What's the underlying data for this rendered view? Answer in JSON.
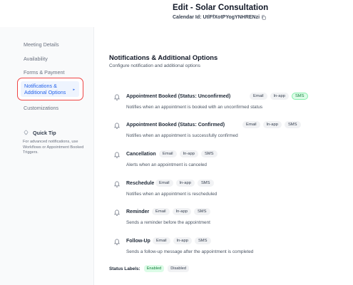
{
  "header": {
    "title": "Edit - Solar Consultation",
    "calendar_id_label": "Calendar Id:",
    "calendar_id": "UtlFfXotPYogYNHRENzi"
  },
  "sidebar": {
    "items": [
      {
        "label": "Meeting Details"
      },
      {
        "label": "Availability"
      },
      {
        "label": "Forms & Payment"
      },
      {
        "label_line1": "Notifications &",
        "label_line2": "Additional Options",
        "active": true
      },
      {
        "label": "Customizations"
      }
    ],
    "quick_tip": {
      "title": "Quick Tip",
      "text": "For advanced notifications, use Workflows or Appointment Booked Triggers."
    }
  },
  "main": {
    "title": "Notifications & Additional Options",
    "subtitle": "Configure notification and additional options",
    "notifications": [
      {
        "title": "Appointment Booked (Status: Unconfirmed)",
        "channels": [
          "Email",
          "In-app",
          "SMS"
        ],
        "description": "Notifies when an appointment is booked with an unconfirmed status",
        "enabled_channel": "SMS"
      },
      {
        "title": "Appointment Booked (Status: Confirmed)",
        "channels": [
          "Email",
          "In-app",
          "SMS"
        ],
        "description": "Notifies when an appointment is successfully confirmed"
      },
      {
        "title": "Cancellation",
        "channels": [
          "Email",
          "In-app",
          "SMS"
        ],
        "description": "Alerts when an appointment is canceled"
      },
      {
        "title": "Reschedule",
        "channels": [
          "Email",
          "In-app",
          "SMS"
        ],
        "description": "Notifies when an appointment is rescheduled"
      },
      {
        "title": "Reminder",
        "channels": [
          "Email",
          "In-app",
          "SMS"
        ],
        "description": "Sends a reminder before the appointment"
      },
      {
        "title": "Follow-Up",
        "channels": [
          "Email",
          "In-app",
          "SMS"
        ],
        "description": "Sends a follow-up message after the appointment is completed"
      }
    ],
    "status_labels": {
      "label": "Status Labels:",
      "enabled": "Enabled",
      "disabled": "Disabled"
    }
  },
  "icons": {
    "bell": "bell-icon",
    "copy": "copy-icon",
    "quick_tip": "lightbulb-icon",
    "chevron": "chevron-right-icon"
  },
  "colors": {
    "accent": "#2563eb",
    "highlight_border": "#ef4444",
    "enabled_bg": "#dcfce7",
    "enabled_text": "#15803d"
  }
}
